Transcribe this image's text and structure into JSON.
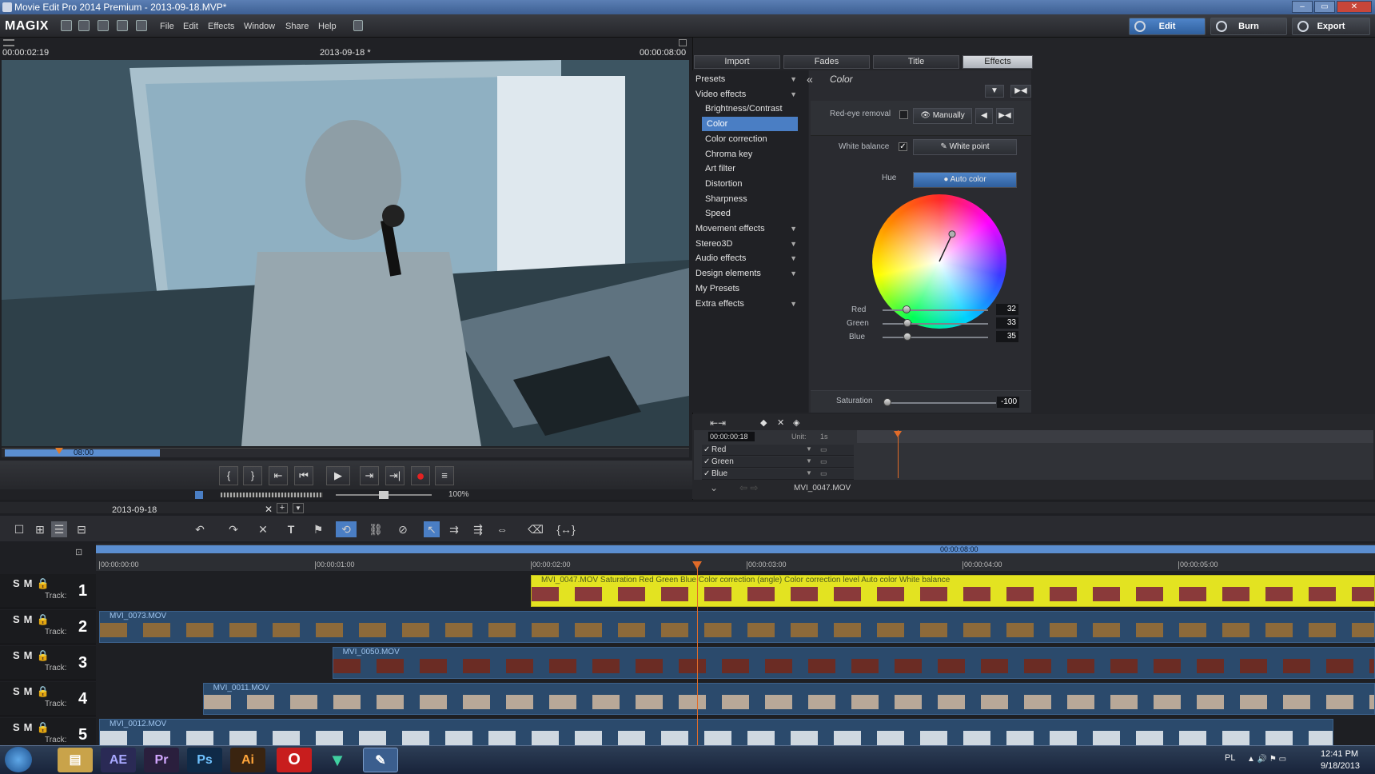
{
  "window": {
    "title": "Movie Edit Pro 2014 Premium - 2013-09-18.MVP*"
  },
  "menubar": {
    "logo": "MAGIX",
    "menus": [
      "File",
      "Edit",
      "Effects",
      "Window",
      "Share",
      "Help"
    ],
    "modes": [
      {
        "label": "Edit",
        "active": true
      },
      {
        "label": "Burn",
        "active": false
      },
      {
        "label": "Export",
        "active": false
      }
    ]
  },
  "monitor": {
    "time_left": "00:00:02:19",
    "project": "2013-09-18 *",
    "time_right": "00:00:08:00",
    "scrub_label": "08:00",
    "zoom": "100%"
  },
  "effects_panel": {
    "tabs": [
      {
        "label": "Import"
      },
      {
        "label": "Fades"
      },
      {
        "label": "Title"
      },
      {
        "label": "Effects",
        "active": true
      }
    ],
    "tree": [
      {
        "label": "Presets",
        "level": 0,
        "expandable": true
      },
      {
        "label": "Video effects",
        "level": 0,
        "expandable": true
      },
      {
        "label": "Brightness/Contrast",
        "level": 1
      },
      {
        "label": "Color",
        "level": 1,
        "selected": true
      },
      {
        "label": "Color correction",
        "level": 1
      },
      {
        "label": "Chroma key",
        "level": 1
      },
      {
        "label": "Art filter",
        "level": 1
      },
      {
        "label": "Distortion",
        "level": 1
      },
      {
        "label": "Sharpness",
        "level": 1
      },
      {
        "label": "Speed",
        "level": 1
      },
      {
        "label": "Movement effects",
        "level": 0,
        "expandable": true
      },
      {
        "label": "Stereo3D",
        "level": 0,
        "expandable": true
      },
      {
        "label": "Audio effects",
        "level": 0,
        "expandable": true
      },
      {
        "label": "Design elements",
        "level": 0,
        "expandable": true
      },
      {
        "label": "My Presets",
        "level": 0
      },
      {
        "label": "Extra effects",
        "level": 0,
        "expandable": true
      }
    ],
    "color": {
      "title": "Color",
      "red_eye_label": "Red-eye removal",
      "manually_label": "Manually",
      "white_balance_label": "White balance",
      "white_balance_checked": true,
      "white_point_label": "White point",
      "hue_label": "Hue",
      "auto_color_label": "Auto color",
      "hue_angle_deg": 25,
      "hue_radius": 0.45,
      "sliders": [
        {
          "label": "Red",
          "value": 32,
          "min": -100,
          "max": 100
        },
        {
          "label": "Green",
          "value": 33,
          "min": -100,
          "max": 100
        },
        {
          "label": "Blue",
          "value": 35,
          "min": -100,
          "max": 100
        }
      ],
      "saturation": {
        "label": "Saturation",
        "value": -100,
        "min": -100,
        "max": 100
      }
    },
    "keyframes": {
      "time": "00:00:00:18",
      "unit_label": "Unit:",
      "unit_value": "1s",
      "rows": [
        "Red",
        "Green",
        "Blue"
      ],
      "clip_name": "MVI_0047.MOV"
    }
  },
  "timeline": {
    "project_tab": "2013-09-18",
    "ruler_labels": [
      "00:00:00:00",
      "00:00:01:00",
      "00:00:02:00",
      "00:00:03:00",
      "00:00:04:00",
      "00:00:05:00"
    ],
    "range_label": "00:00:08:00",
    "track_label": "Track:",
    "tracks": [
      {
        "num": "1",
        "clip": "MVI_0047.MOV   Saturation  Red  Green  Blue  Color correction (angle)  Color correction level  Auto color  White balance",
        "start_s": 2.0,
        "end_s": 6.0,
        "color": "#e3e321"
      },
      {
        "num": "2",
        "clip": "MVI_0073.MOV",
        "start_s": 0.0,
        "end_s": 6.0,
        "color": "#2b4a6c"
      },
      {
        "num": "3",
        "clip": "MVI_0050.MOV",
        "start_s": 1.08,
        "end_s": 6.0,
        "color": "#2b4a6c"
      },
      {
        "num": "4",
        "clip": "MVI_0011.MOV",
        "start_s": 0.48,
        "end_s": 6.0,
        "color": "#2b4a6c"
      },
      {
        "num": "5",
        "clip": "MVI_0012.MOV",
        "start_s": 0.0,
        "end_s": 5.72,
        "color": "#2b4a6c"
      }
    ],
    "playhead_s": 2.77
  },
  "taskbar": {
    "apps": [
      "AE",
      "Pr",
      "Ps",
      "Ai"
    ],
    "lang": "PL",
    "time": "12:41 PM",
    "date": "9/18/2013"
  }
}
